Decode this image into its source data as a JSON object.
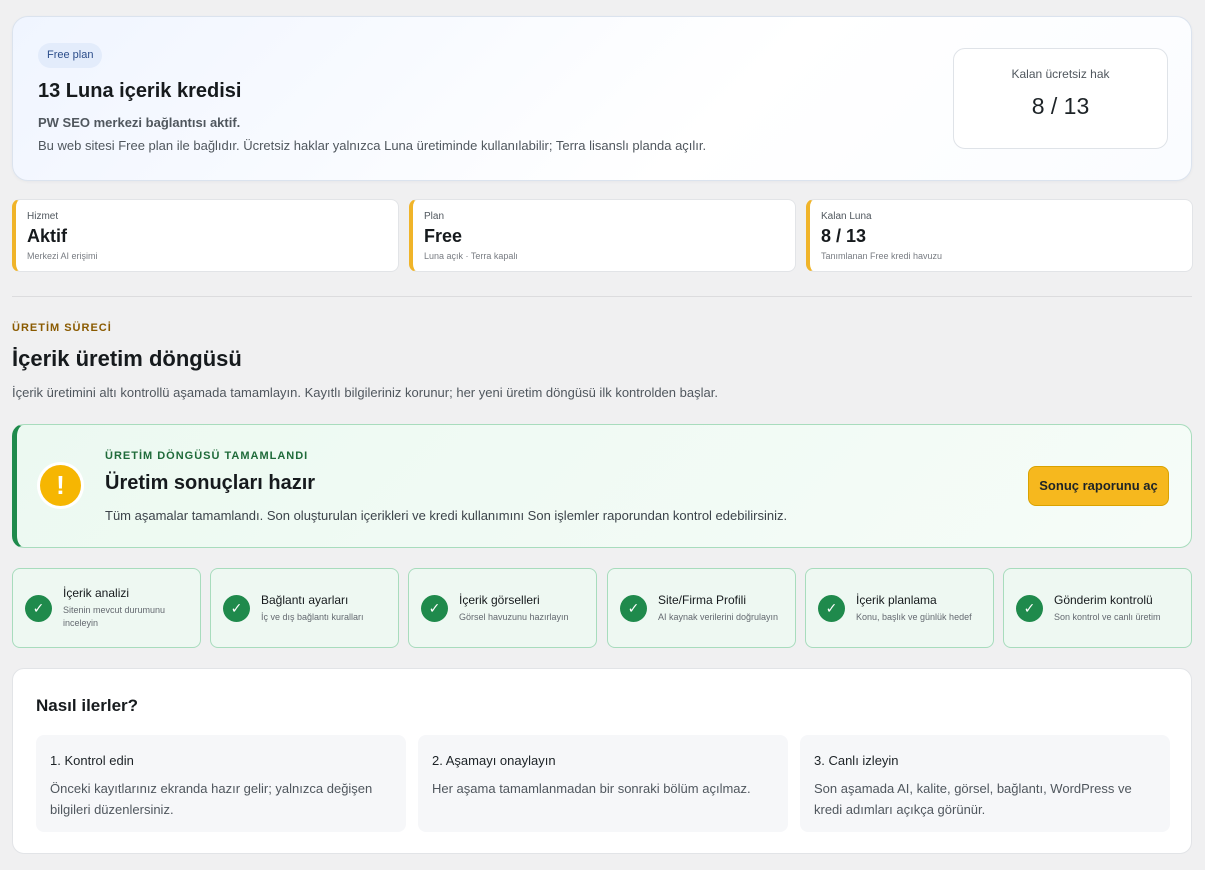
{
  "hero": {
    "badge": "Free plan",
    "title": "13 Luna içerik kredisi",
    "subtitle": "PW SEO merkezi bağlantısı aktif.",
    "description": "Bu web sitesi Free plan ile bağlıdır. Ücretsiz haklar yalnızca Luna üretiminde kullanılabilir; Terra lisanslı planda açılır.",
    "credit_label": "Kalan ücretsiz hak",
    "credit_value": "8 / 13"
  },
  "stats": [
    {
      "label": "Hizmet",
      "value": "Aktif",
      "hint": "Merkezi AI erişimi"
    },
    {
      "label": "Plan",
      "value": "Free",
      "hint": "Luna açık · Terra kapalı"
    },
    {
      "label": "Kalan Luna",
      "value": "8 / 13",
      "hint": "Tanımlanan Free kredi havuzu"
    }
  ],
  "section": {
    "eyebrow": "ÜRETİM SÜRECİ",
    "title": "İçerik üretim döngüsü",
    "description": "İçerik üretimini altı kontrollü aşamada tamamlayın. Kayıtlı bilgileriniz korunur; her yeni üretim döngüsü ilk kontrolden başlar."
  },
  "completion": {
    "eyebrow": "ÜRETİM DÖNGÜSÜ TAMAMLANDI",
    "title": "Üretim sonuçları hazır",
    "description": "Tüm aşamalar tamamlandı. Son oluşturulan içerikleri ve kredi kullanımını Son işlemler raporundan kontrol edebilirsiniz.",
    "button_label": "Sonuç raporunu aç",
    "icon_glyph": "!"
  },
  "steps": [
    {
      "title": "İçerik analizi",
      "desc": "Sitenin mevcut durumunu inceleyin"
    },
    {
      "title": "Bağlantı ayarları",
      "desc": "İç ve dış bağlantı kuralları"
    },
    {
      "title": "İçerik görselleri",
      "desc": "Görsel havuzunu hazırlayın"
    },
    {
      "title": "Site/Firma Profili",
      "desc": "AI kaynak verilerini doğrulayın"
    },
    {
      "title": "İçerik planlama",
      "desc": "Konu, başlık ve günlük hedef"
    },
    {
      "title": "Gönderim kontrolü",
      "desc": "Son kontrol ve canlı üretim"
    }
  ],
  "check_glyph": "✓",
  "how": {
    "title": "Nasıl ilerler?",
    "cards": [
      {
        "title": "1. Kontrol edin",
        "desc": "Önceki kayıtlarınız ekranda hazır gelir; yalnızca değişen bilgileri düzenlersiniz."
      },
      {
        "title": "2. Aşamayı onaylayın",
        "desc": "Her aşama tamamlanmadan bir sonraki bölüm açılmaz."
      },
      {
        "title": "3. Canlı izleyin",
        "desc": "Son aşamada AI, kalite, görsel, bağlantı, WordPress ve kredi adımları açıkça görünür."
      }
    ]
  },
  "colors": {
    "accent": "#f0b429",
    "success": "#1f8a4c",
    "warning": "#f6b602",
    "button": "#f6b81e"
  }
}
